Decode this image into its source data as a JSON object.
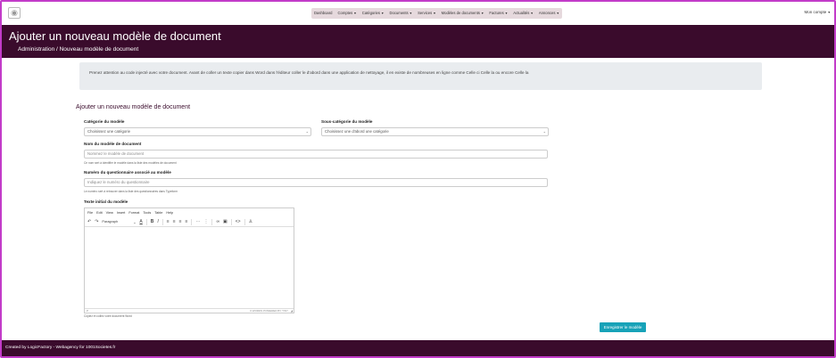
{
  "nav": {
    "logo_icon": "cat-icon",
    "items": [
      {
        "label": "Dashboard",
        "dropdown": false
      },
      {
        "label": "Comptes",
        "dropdown": true
      },
      {
        "label": "Catégories",
        "dropdown": true
      },
      {
        "label": "Documents",
        "dropdown": true
      },
      {
        "label": "Services",
        "dropdown": true
      },
      {
        "label": "Modèles de documents",
        "dropdown": true
      },
      {
        "label": "Factures",
        "dropdown": true
      },
      {
        "label": "Actualités",
        "dropdown": true
      },
      {
        "label": "Annonces",
        "dropdown": true
      }
    ],
    "account_label": "Mon compte"
  },
  "header": {
    "title": "Ajouter un nouveau modèle de document",
    "breadcrumb": "Administration / Nouveau modèle de document"
  },
  "notice": {
    "text": "Prenez attention au code injecté avec votre document. Avant de coller un texte copier dans Word dans l'éditeur coller le d'abord dans une application de nettoyage, il en existe de nombreuses en ligne comme Celle ci Celle la ou encore Celle la"
  },
  "form": {
    "title": "Ajouter un nouveau modèle de document",
    "category": {
      "label": "Catégorie du modèle",
      "value": "Choisissez une catégorie"
    },
    "subcategory": {
      "label": "Sous-catégorie du modèle",
      "value": "Choisissez une d'abord une catégorie"
    },
    "name": {
      "label": "Nom du modèle de document",
      "placeholder": "Nommez le modèle de document",
      "help": "Ce nom sert à identifier le modèle dans la liste des modèles de document"
    },
    "questionnaire": {
      "label": "Numéro du questionnaire associé au modèle",
      "placeholder": "Indiquez le numéro du questionnaire",
      "help": "Le numéro sert à retrouver dans la liste des questionnaires dans Typeform"
    },
    "initial_text": {
      "label": "Texte initial du modèle",
      "help": "Copiez et collez votre document Word"
    },
    "save_label": "Enregistrer le modèle"
  },
  "editor": {
    "menus": [
      "File",
      "Edit",
      "View",
      "Insert",
      "Format",
      "Tools",
      "Table",
      "Help"
    ],
    "block_format": "Paragraph",
    "status_left": "P",
    "status_right": "0 WORDS POWERED BY TINY"
  },
  "footer": {
    "text": "Created by LogicFactory - Webagency for 1001Societes.fr"
  },
  "colors": {
    "brand_dark": "#3a0b2c",
    "button": "#17a2b8",
    "frame_border": "#c23bc9"
  }
}
